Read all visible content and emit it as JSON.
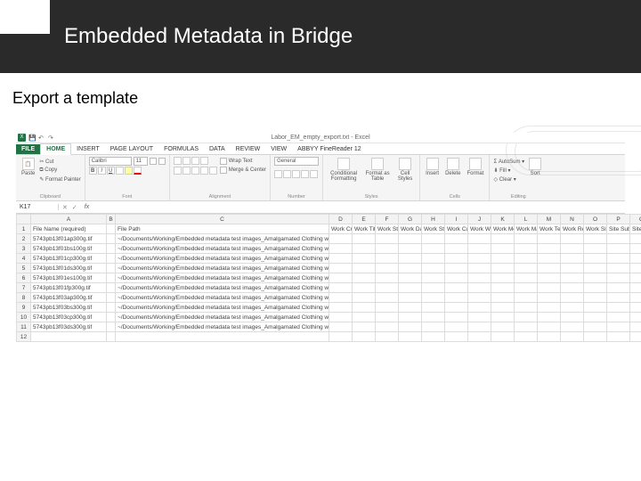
{
  "slide": {
    "title": "Embedded Metadata in Bridge",
    "subtitle": "Export a template"
  },
  "titlebar": {
    "doc_name": "Labor_EM_empty_export.txt - Excel",
    "qat": {
      "logo": "X",
      "save": "💾",
      "undo": "↶",
      "redo": "↷"
    }
  },
  "tabs": {
    "file": "FILE",
    "home": "HOME",
    "insert": "INSERT",
    "page_layout": "PAGE LAYOUT",
    "formulas": "FORMULAS",
    "data": "DATA",
    "review": "REVIEW",
    "view": "VIEW",
    "abbyy": "ABBYY FineReader 12"
  },
  "ribbon": {
    "clipboard": {
      "label": "Clipboard",
      "paste": "Paste",
      "cut": "✂ Cut",
      "copy": "⧉ Copy",
      "painter": "✎ Format Painter"
    },
    "font": {
      "label": "Font",
      "name": "Calibri",
      "size": "11",
      "bold": "B",
      "italic": "I",
      "underline": "U"
    },
    "alignment": {
      "label": "Alignment",
      "wrap": "Wrap Text",
      "merge": "Merge & Center"
    },
    "number": {
      "label": "Number",
      "format": "General"
    },
    "styles": {
      "label": "Styles",
      "cond": "Conditional Formatting",
      "table": "Format as Table",
      "cell": "Cell Styles"
    },
    "cells": {
      "label": "Cells",
      "insert": "Insert",
      "delete": "Delete",
      "format": "Format"
    },
    "editing": {
      "label": "Editing",
      "autosum": "Σ AutoSum ▾",
      "fill": "⬇ Fill ▾",
      "clear": "◇ Clear ▾",
      "sort": "Sort"
    }
  },
  "formula_bar": {
    "name_box": "K17",
    "fx": "fx",
    "cancel": "✕",
    "enter": "✓"
  },
  "columns": [
    "A",
    "B",
    "C",
    "D",
    "E",
    "F",
    "G",
    "H",
    "I",
    "J",
    "K",
    "L",
    "M",
    "N",
    "O",
    "P",
    "Q"
  ],
  "headers_row": {
    "A": "File Name (required)",
    "C": "File Path",
    "D": "Work Crea",
    "E": "Work Title",
    "F": "Work Styl",
    "G": "Work Date",
    "H": "Work Styl",
    "I": "Work Cult",
    "J": "Work Wor",
    "K": "Work Mea",
    "L": "Work Mat",
    "M": "Work Tec",
    "N": "Work Rep",
    "O": "Work Site",
    "P": "Site Sub",
    "Q": "Site City"
  },
  "rows": [
    {
      "n": 2,
      "fn": "5743pb13f01ap300g.tif",
      "path": "~/Documents/Working/Embedded metadata test images_Amalgamated Clothing workers/"
    },
    {
      "n": 3,
      "fn": "5743pb13f01bs100g.tif",
      "path": "~/Documents/Working/Embedded metadata test images_Amalgamated Clothing workers/"
    },
    {
      "n": 4,
      "fn": "5743pb13f01cp300g.tif",
      "path": "~/Documents/Working/Embedded metadata test images_Amalgamated Clothing workers/"
    },
    {
      "n": 5,
      "fn": "5743pb13f01ds300g.tif",
      "path": "~/Documents/Working/Embedded metadata test images_Amalgamated Clothing workers/"
    },
    {
      "n": 6,
      "fn": "5743pb13f01es100g.tif",
      "path": "~/Documents/Working/Embedded metadata test images_Amalgamated Clothing workers/"
    },
    {
      "n": 7,
      "fn": "5743pb13f01fp300g.tif",
      "path": "~/Documents/Working/Embedded metadata test images_Amalgamated Clothing workers/"
    },
    {
      "n": 8,
      "fn": "5743pb13f03ap300g.tif",
      "path": "~/Documents/Working/Embedded metadata test images_Amalgamated Clothing workers/"
    },
    {
      "n": 9,
      "fn": "5743pb13f03bs300g.tif",
      "path": "~/Documents/Working/Embedded metadata test images_Amalgamated Clothing workers/"
    },
    {
      "n": 10,
      "fn": "5743pb13f03cp300g.tif",
      "path": "~/Documents/Working/Embedded metadata test images_Amalgamated Clothing workers/"
    },
    {
      "n": 11,
      "fn": "5743pb13f03ds300g.tif",
      "path": "~/Documents/Working/Embedded metadata test images_Amalgamated Clothing workers/"
    }
  ],
  "blank_rows": [
    12
  ]
}
